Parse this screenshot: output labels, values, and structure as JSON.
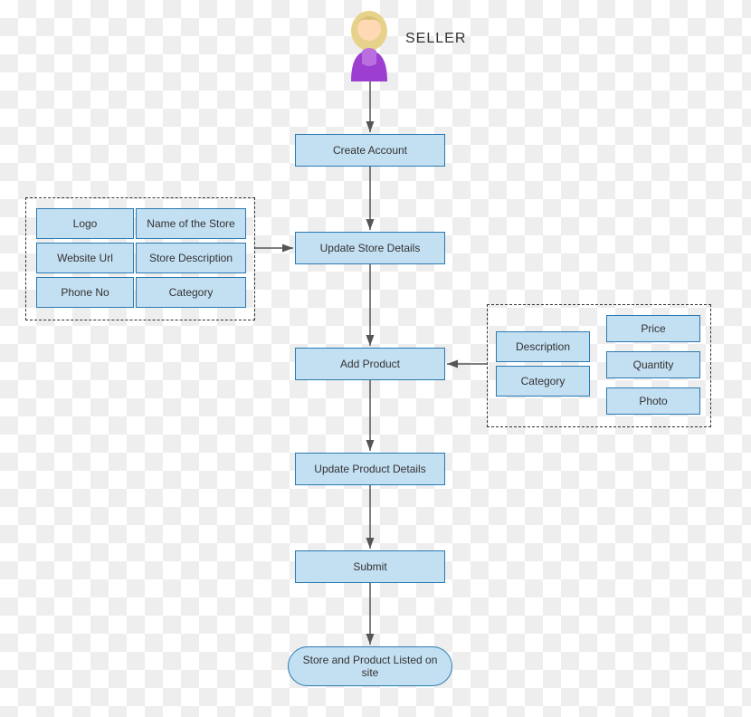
{
  "actor_label": "SELLER",
  "steps": {
    "create_account": "Create Account",
    "update_store": "Update Store Details",
    "add_product": "Add  Product",
    "update_product": "Update Product Details",
    "submit": "Submit",
    "terminator": "Store and Product Listed on site"
  },
  "store_details": {
    "r1c1": "Logo",
    "r1c2": "Name of the Store",
    "r2c1": "Website Url",
    "r2c2": "Store Description",
    "r3c1": "Phone No",
    "r3c2": "Category"
  },
  "product_details": {
    "leftTop": "Description",
    "leftBottom": "Category",
    "rightTop": "Price",
    "rightMid": "Quantity",
    "rightBottom": "Photo"
  }
}
